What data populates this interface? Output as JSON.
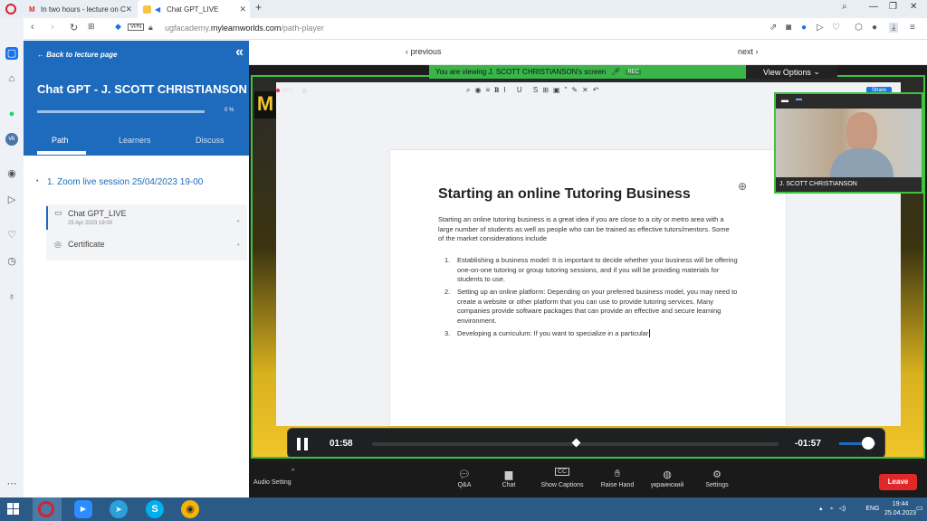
{
  "browser": {
    "tabs": [
      {
        "label": "In two hours - lecture on C"
      },
      {
        "label": "Chat GPT_LIVE"
      }
    ],
    "url_host": "ugfacademy.",
    "url_domain": "mylearnworlds.com",
    "url_path": "/path-player",
    "vpn_label": "VPN"
  },
  "lms": {
    "back_link": "Back to lecture page",
    "course_title": "Chat GPT - J. SCOTT CHRISTIANSON",
    "progress_label": "0 %",
    "progress_value": 0,
    "tabs": [
      "Path",
      "Learners",
      "Discuss"
    ],
    "section_title": "1. Zoom live session 25/04/2023 19-00",
    "items": [
      {
        "title": "Chat GPT_LIVE",
        "date": "25 Apr 2023 19:00"
      },
      {
        "title": "Certificate",
        "date": ""
      }
    ]
  },
  "player": {
    "previous_label": "‹ previous",
    "next_label": "next ›",
    "current_time": "01:58",
    "remaining_time": "-01:57",
    "progress_fraction": 0.5,
    "volume_fraction": 0.8
  },
  "zoom": {
    "viewing_banner": "You are viewing J. SCOTT CHRISTIANSON's screen",
    "banner_rec": "REC",
    "view_options": "View Options",
    "rec_label": "REC",
    "speaker_name": "J. SCOTT CHRISTIANSON",
    "toolbar": [
      {
        "label": "Q&A",
        "icon": "qa-icon"
      },
      {
        "label": "Chat",
        "icon": "chat-icon"
      },
      {
        "label": "Show Captions",
        "icon": "cc-icon"
      },
      {
        "label": "Raise Hand",
        "icon": "hand-icon"
      },
      {
        "label": "украинский",
        "icon": "globe-icon"
      },
      {
        "label": "Settings",
        "icon": "gear-icon"
      }
    ],
    "audio_setting": "Audio Setting",
    "leave_label": "Leave"
  },
  "doc": {
    "title": "Starting an online Tutoring Business",
    "share_label": "Share",
    "intro": "Starting an online tutoring business is a great idea if you are close to a city or metro area with a large number of students as well as people who can be trained as effective tutors/mentors. Some of the market considerations include",
    "list": [
      {
        "n": "1.",
        "text": "Establishing a business model: It is important to decide whether your business will be offering one-on-one tutoring or group tutoring sessions, and if you will be providing materials for students to use."
      },
      {
        "n": "2.",
        "text": "Setting up an online platform: Depending on your preferred business model, you may need to create a website or other platform that you can use to provide tutoring services. Many companies provide software packages that can provide an effective and secure learning environment."
      },
      {
        "n": "3.",
        "text": "Developing a curriculum: If you want to specialize in a particular"
      }
    ]
  },
  "taskbar": {
    "lang": "ENG",
    "time": "19:44",
    "date": "25.04.2023"
  },
  "colors": {
    "lms_blue": "#1e6bbd",
    "zoom_green": "#3fc33f",
    "leave_red": "#e02828",
    "taskbar": "#2b5a86"
  }
}
